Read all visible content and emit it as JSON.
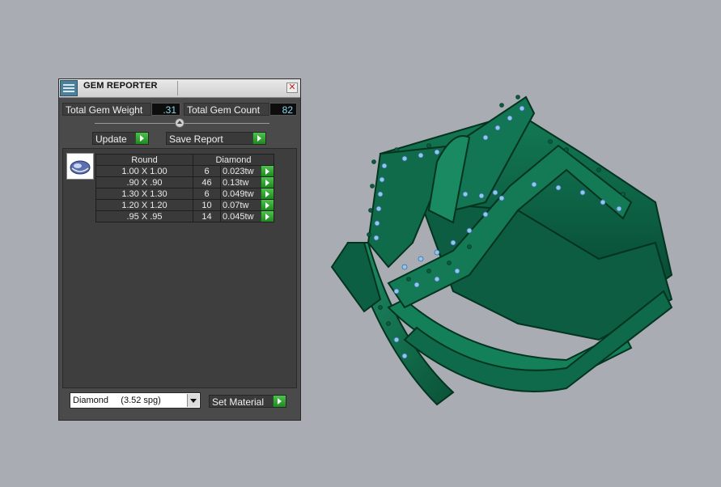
{
  "panel": {
    "title": "GEM REPORTER",
    "close_symbol": "✕",
    "total_weight_label": "Total Gem Weight",
    "total_weight_value": ".31",
    "total_count_label": "Total Gem Count",
    "total_count_value": "82",
    "update_label": "Update",
    "save_report_label": "Save Report",
    "table": {
      "header_shape": "Round",
      "header_material": "Diamond",
      "rows": [
        {
          "size": "1.00 X 1.00",
          "count": "6",
          "weight": "0.023tw"
        },
        {
          "size": ".90 X .90",
          "count": "46",
          "weight": "0.13tw"
        },
        {
          "size": "1.30 X 1.30",
          "count": "6",
          "weight": "0.049tw"
        },
        {
          "size": "1.20 X 1.20",
          "count": "10",
          "weight": "0.07tw"
        },
        {
          "size": ".95 X .95",
          "count": "14",
          "weight": "0.045tw"
        }
      ]
    },
    "material_select": "Diamond     (3.52 spg)",
    "set_material_label": "Set Material"
  },
  "colors": {
    "viewport_bg": "#a9adb3",
    "panel_bg": "#4a4a4a",
    "value_text": "#8fd8f0",
    "ring_green": "#0f6b4a",
    "gem_blue": "#8fc7f2",
    "go_button_green": "#2aa12a"
  },
  "icons": {
    "title_icon": "gem-reporter-icon",
    "close": "close-icon",
    "go": "green-arrow-icon",
    "gem": "round-gem-icon",
    "dropdown": "chevron-down-icon"
  }
}
